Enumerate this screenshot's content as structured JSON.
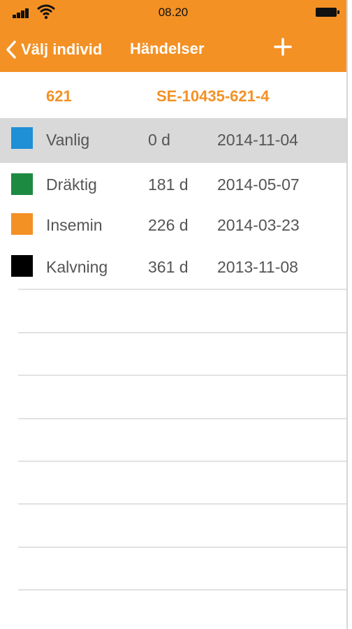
{
  "status_bar": {
    "time": "08.20",
    "icons": [
      "signal-icon",
      "wifi-icon",
      "battery-icon"
    ]
  },
  "nav": {
    "back_label": "Välj individ",
    "back_icon": "chevron-left-icon",
    "title": "Händelser",
    "add_icon": "plus-icon"
  },
  "animal": {
    "short_id": "621",
    "full_id": "SE-10435-621-4"
  },
  "events": [
    {
      "name": "Vanlig",
      "days": "0 d",
      "date": "2014-11-04",
      "color": "#1f8fd6",
      "selected": true
    },
    {
      "name": "Dräktig",
      "days": "181 d",
      "date": "2014-05-07",
      "color": "#1d8a42",
      "selected": false
    },
    {
      "name": "Insemin",
      "days": "226 d",
      "date": "2014-03-23",
      "color": "#f39125",
      "selected": false
    },
    {
      "name": "Kalvning",
      "days": "361 d",
      "date": "2013-11-08",
      "color": "#000000",
      "selected": false
    }
  ],
  "colors": {
    "accent": "#f39125",
    "selected_row": "#d9d9da",
    "text": "#555555"
  }
}
